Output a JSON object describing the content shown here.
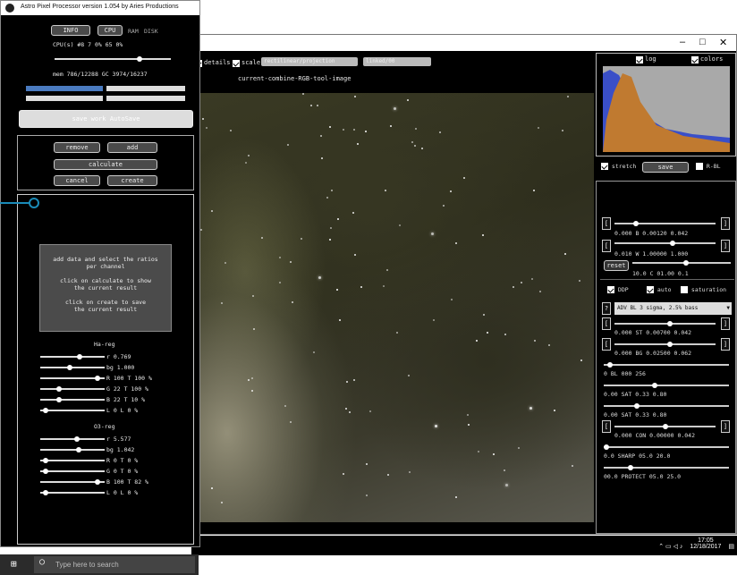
{
  "tool_window": {
    "title": "Astro Pixel Processor version 1.054 by Aries Productions",
    "tabs": {
      "info": "INFO",
      "cpu": "CPU",
      "ram": "RAM",
      "disk": "DISK"
    },
    "cpu_row": "CPU(s) #8   7  0%   65 0%",
    "mem_row": "mem 786/12288  GC 3974/16237",
    "banner_button": "save work AutoSave",
    "buttons": {
      "remove": "remove",
      "add": "add",
      "calculate": "calculate",
      "cancel": "cancel",
      "create": "create"
    },
    "help_text": [
      "add data and select the ratios",
      "per channel",
      "",
      "click on calculate to show",
      "the current result",
      "",
      "click on create to save",
      "the current result"
    ],
    "ha_reg": {
      "title": "Ha-reg",
      "rows": [
        {
          "label": "r 0.769",
          "value": 0.62
        },
        {
          "label": "bg 1.000",
          "value": 0.45
        },
        {
          "label": "R 100   T 100 %",
          "value": 0.93
        },
        {
          "label": "G 22   T 100 %",
          "value": 0.28
        },
        {
          "label": "B 22   T 10 %",
          "value": 0.28
        },
        {
          "label": "L 0   L 0 %",
          "value": 0.04
        }
      ]
    },
    "o3_reg": {
      "title": "O3-reg",
      "rows": [
        {
          "label": "r 5.577",
          "value": 0.58
        },
        {
          "label": "bg 1.042",
          "value": 0.6
        },
        {
          "label": "R 0   T 0 %",
          "value": 0.04
        },
        {
          "label": "G 0   T 0 %",
          "value": 0.04
        },
        {
          "label": "B 100   T 82 %",
          "value": 0.93
        },
        {
          "label": "L 0   L 0 %",
          "value": 0.04
        }
      ]
    }
  },
  "main_window": {
    "toolbar": {
      "details": "details",
      "scale": "scale",
      "combo1": "rectilinear/projection",
      "combo2": "linked/00",
      "image_name": "current-combine-RGB-tool-image"
    },
    "histogram": {
      "log": "log",
      "colors": "colors"
    },
    "stretch_row": {
      "stretch": "stretch",
      "save": "save",
      "hdr": "R-BL"
    },
    "sliders": [
      {
        "label": "0.000   B 0.00120   0.042",
        "value": 0.2
      },
      {
        "label": "0.010   W 1.00000   1.000",
        "value": 0.6
      },
      {
        "label": "10.0   C 01.00   0.1",
        "value": 0.55
      }
    ],
    "reset_label": "reset",
    "options_row": {
      "ddp": "DDP",
      "auto": "auto",
      "saturation": "saturation"
    },
    "preset": "ADV BL 3 sigma, 2.5% bass",
    "param_sliders": [
      {
        "label": "0.000   ST 0.00700   0.042",
        "value": 0.55
      },
      {
        "label": "0.000   BG 0.02500   0.062",
        "value": 0.55
      },
      {
        "label": "0   BL 000   256",
        "value": 0.03
      },
      {
        "label": "0.00   SAT 0.33   0.80",
        "value": 0.4
      },
      {
        "label": "0.00   SAT 0.33   0.80",
        "value": 0.25
      },
      {
        "label": "0.000   CON 0.00000   0.042",
        "value": 0.5
      },
      {
        "label": "0.0   SHARP 05.0   20.0",
        "value": 0.0
      },
      {
        "label": "00.0   PROTECT 05.0   25.0",
        "value": 0.2
      }
    ],
    "tray": {
      "time": "17:05",
      "date": "12/18/2017"
    }
  },
  "taskbar": {
    "search_placeholder": "Type here to search"
  },
  "colors": {
    "accent": "#1a8bb8"
  }
}
